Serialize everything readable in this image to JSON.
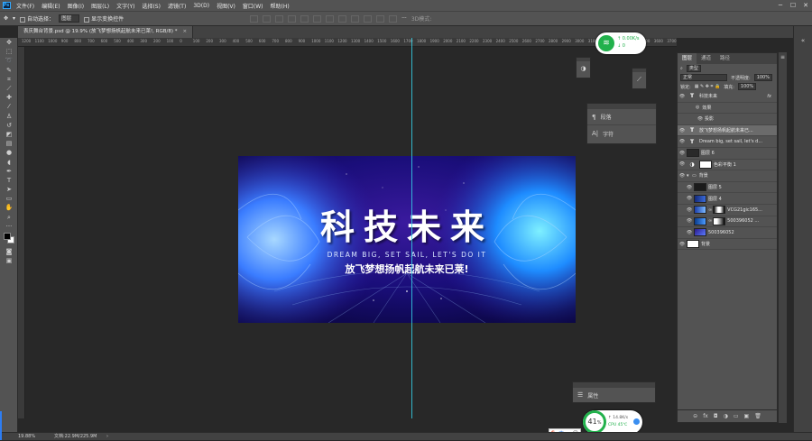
{
  "colors": {
    "guide": "#35d0e6",
    "panel": "#535353",
    "canvas_bg": "#282828",
    "accent_green": "#22b14c"
  },
  "menu": {
    "app_icon": "Ps",
    "items": [
      "文件(F)",
      "编辑(E)",
      "图像(I)",
      "图层(L)",
      "文字(Y)",
      "选择(S)",
      "滤镜(T)",
      "3D(D)",
      "视图(V)",
      "窗口(W)",
      "帮助(H)"
    ]
  },
  "options_bar": {
    "auto_select_label": "自动选择：",
    "auto_select_value": "图层",
    "transform_label": "显示变换控件"
  },
  "doc_tab": {
    "title": "表庆舞台背景.psd @ 19.9% (放飞梦想扬帆起航未来已莱!, RGB/8) *",
    "close": "×"
  },
  "ruler_ticks": [
    "1200",
    "1100",
    "1000",
    "900",
    "800",
    "700",
    "600",
    "500",
    "400",
    "300",
    "200",
    "100",
    "0",
    "100",
    "200",
    "300",
    "400",
    "500",
    "600",
    "700",
    "800",
    "900",
    "1000",
    "1100",
    "1200",
    "1300",
    "1400",
    "1500",
    "1600",
    "1700",
    "1800",
    "1900",
    "2000",
    "2100",
    "2200",
    "2300",
    "2400",
    "2500",
    "2600",
    "2700",
    "2800",
    "2900",
    "3000",
    "3100",
    "3200",
    "3300",
    "3400",
    "3500",
    "3600",
    "3700"
  ],
  "artwork": {
    "title": "科技未来",
    "subtitle_en": "DREAM BIG, SET SAIL, LET'S DO IT",
    "subtitle_cn": "放飞梦想扬帆起航未来已莱!"
  },
  "mini_panels": {
    "paragraph": "段落",
    "character": "字符",
    "properties": "属性"
  },
  "layers_panel": {
    "tabs": [
      "图层",
      "通道",
      "路径"
    ],
    "filter_label": "类型",
    "blend_mode": "正常",
    "opacity_label": "不透明度:",
    "opacity_value": "100%",
    "lock_label": "锁定:",
    "fill_label": "填充:",
    "fill_value": "100%",
    "layers": [
      {
        "name": "科技未来",
        "kind": "text",
        "fx": "fx"
      },
      {
        "name": "效果",
        "kind": "effect"
      },
      {
        "name": "投影",
        "kind": "effect2"
      },
      {
        "name": "放飞梦想扬帆起航未来已...",
        "kind": "text",
        "selected": true
      },
      {
        "name": "Dream big, set sail, let's d...",
        "kind": "text"
      },
      {
        "name": "图层 6",
        "kind": "image"
      },
      {
        "name": "色彩平衡 1",
        "kind": "adjust"
      },
      {
        "name": "背景",
        "kind": "group"
      },
      {
        "name": "图层 5",
        "kind": "image"
      },
      {
        "name": "图层 4",
        "kind": "image"
      },
      {
        "name": "VCG21gic165...",
        "kind": "masked"
      },
      {
        "name": "500396052 ...",
        "kind": "masked"
      },
      {
        "name": "500396052",
        "kind": "image"
      },
      {
        "name": "背景",
        "kind": "white"
      }
    ],
    "footer_icons": [
      "link-icon",
      "fx-icon",
      "mask-icon",
      "adjustment-icon",
      "folder-icon",
      "new-layer-icon",
      "trash-icon"
    ],
    "footer_glyphs": [
      "⊝",
      "fx",
      "◘",
      "◑",
      "▭",
      "▣",
      "🗑"
    ]
  },
  "status": {
    "zoom": "19.88%",
    "doc": "文档:22.9M/225.9M"
  },
  "net_widget": {
    "icon": "wifi-icon",
    "up": "↑ 0.00K/s",
    "down": "↓ 0"
  },
  "cpu_widget": {
    "percent": "41",
    "percent_sign": "%",
    "net": "↑ 14.8K/s",
    "cpu": "CPU 45℃"
  },
  "ime": {
    "items": [
      "S",
      "中",
      "·",
      "☺"
    ]
  }
}
